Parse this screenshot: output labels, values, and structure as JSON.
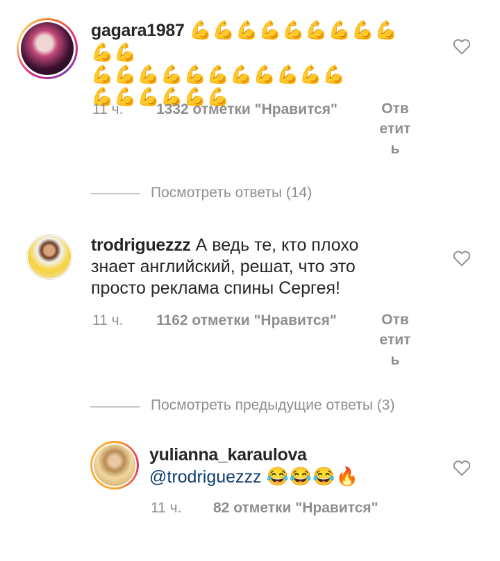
{
  "comments": [
    {
      "username": "gagara1987",
      "text_line1": "💪💪💪💪💪💪💪💪💪💪💪",
      "text_line2": "💪💪💪💪💪💪💪💪💪💪💪",
      "text_line3": "💪💪💪💪💪💪",
      "time": "11 ч.",
      "likes": "1332 отметки \"Нравится\"",
      "reply_label": "Ответить",
      "view_replies": "Посмотреть ответы (14)"
    },
    {
      "username": "trodriguezzz",
      "text_line1": " А ведь те, кто плохо",
      "text_line2": "знает английский, решат, что это",
      "text_line3": "просто реклама спины Сергея!",
      "time": "11 ч.",
      "likes": "1162 отметки \"Нравится\"",
      "reply_label": "Ответить",
      "view_replies": "Посмотреть предыдущие ответы (3)"
    },
    {
      "username": "yulianna_karaulova",
      "mention": "@trodriguezzz",
      "emoji": "😂😂😂🔥",
      "time": "11 ч.",
      "likes": "82 отметки \"Нравится\""
    }
  ],
  "icons": {
    "like": "heart-outline-icon"
  }
}
